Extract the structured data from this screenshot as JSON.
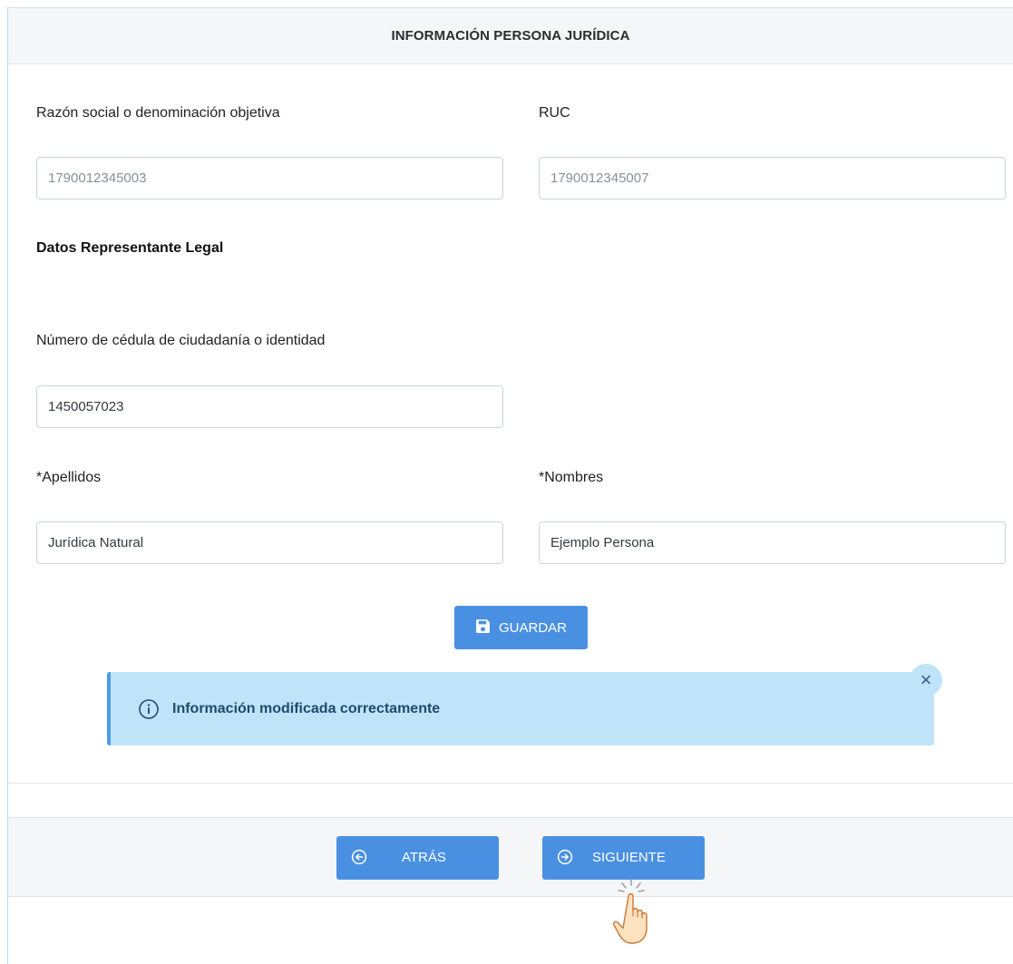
{
  "header": {
    "title": "INFORMACIÓN PERSONA JURÍDICA"
  },
  "company": {
    "razon_social_label": "Razón social o denominación objetiva",
    "razon_social_value": "1790012345003",
    "ruc_label": "RUC",
    "ruc_value": "1790012345007"
  },
  "representative": {
    "section_title": "Datos Representante Legal",
    "cedula_label": "Número de cédula de ciudadanía o identidad",
    "cedula_value": "1450057023",
    "apellidos_label": "*Apellidos",
    "apellidos_value": "Jurídica Natural",
    "nombres_label": "*Nombres",
    "nombres_value": "Ejemplo Persona"
  },
  "actions": {
    "save_label": "GUARDAR"
  },
  "alert": {
    "message": "Información modificada correctamente",
    "close_glyph": "×"
  },
  "footer": {
    "back_label": "ATRÁS",
    "next_label": "SIGUIENTE"
  },
  "colors": {
    "primary": "#4a90e2",
    "alert_bg": "#bfe3f9",
    "alert_border": "#4a9de0",
    "alert_text": "#1f4a6e",
    "header_bg": "#f5f6f8"
  },
  "icons": {
    "save": "floppy-disk-icon",
    "info": "info-circle-icon",
    "close": "close-icon",
    "back": "arrow-left-circle-icon",
    "next": "arrow-right-circle-icon",
    "cursor": "hand-pointer-icon"
  }
}
